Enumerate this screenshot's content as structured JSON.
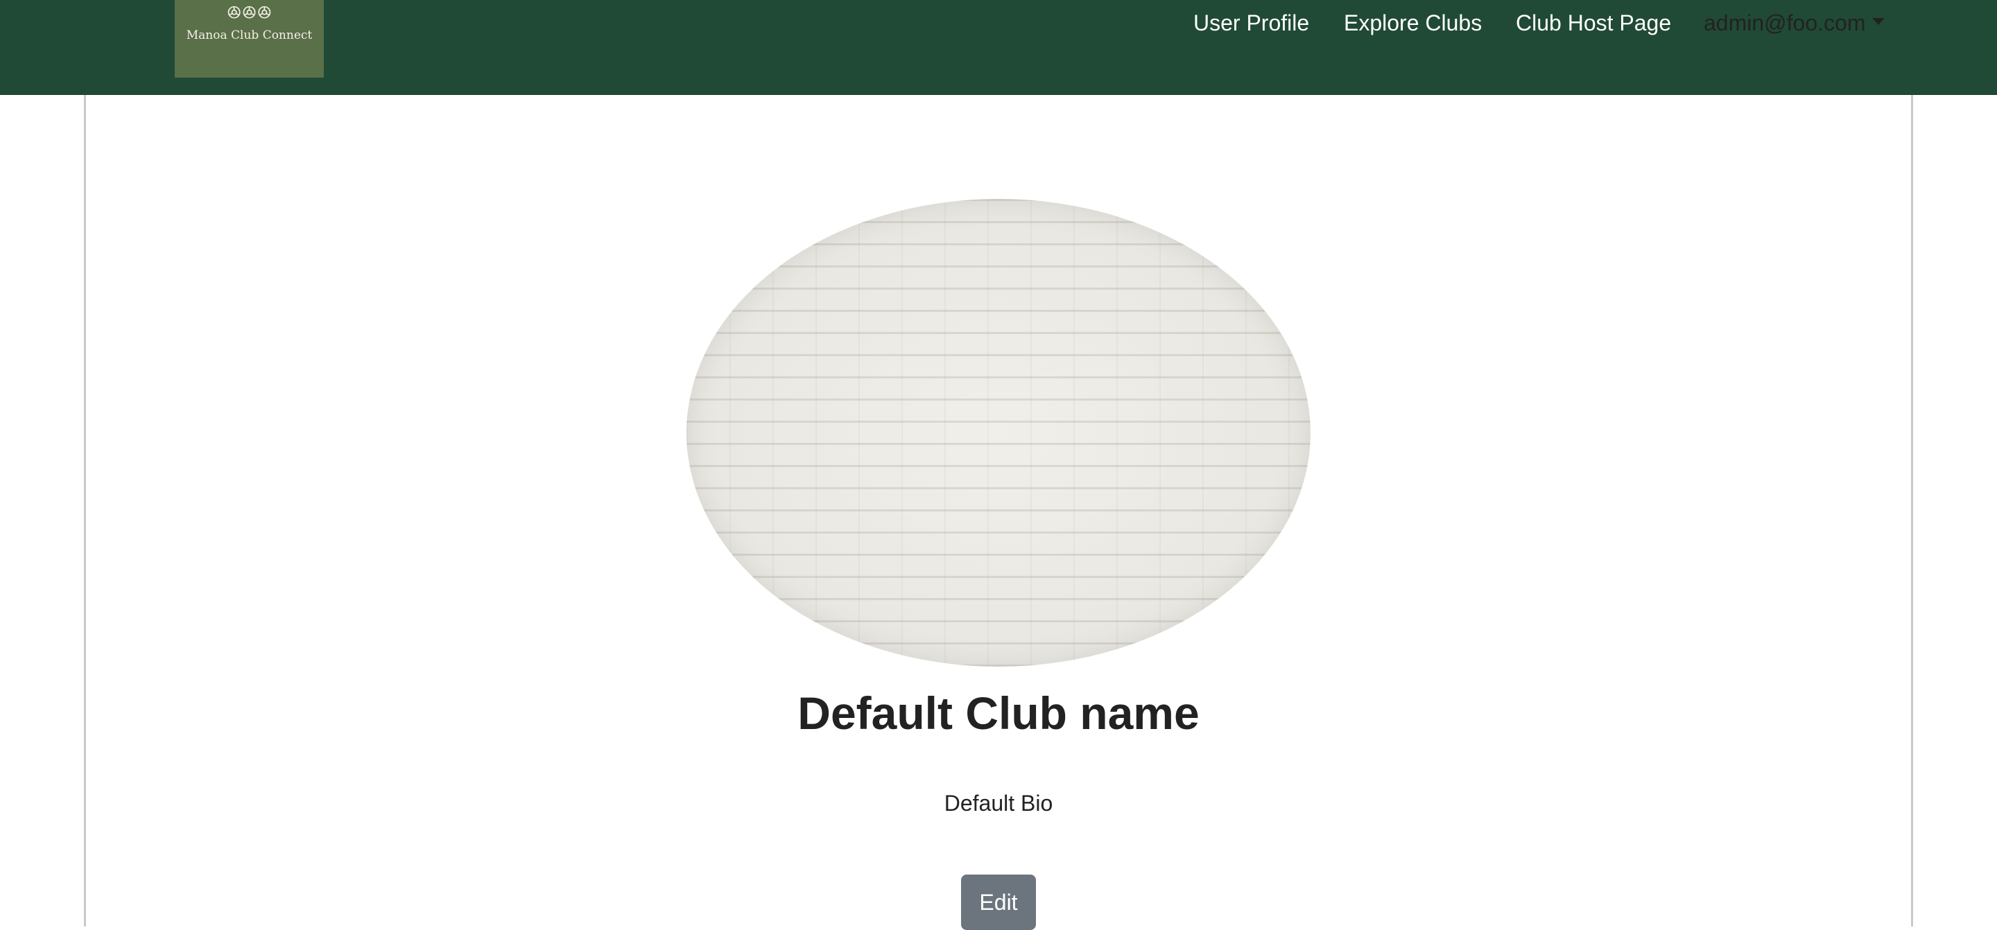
{
  "navbar": {
    "logo_text": "Manoa Club Connect",
    "logo_mark": "ꔮꔮꔮ",
    "links": [
      "User Profile",
      "Explore Clubs",
      "Club Host Page"
    ],
    "user_email": "admin@foo.com"
  },
  "club": {
    "name": "Default Club name",
    "bio": "Default Bio",
    "edit_label": "Edit"
  },
  "colors": {
    "navbar_bg": "#204a35",
    "logo_bg": "#5a7049",
    "edit_button_bg": "#6c757d"
  }
}
